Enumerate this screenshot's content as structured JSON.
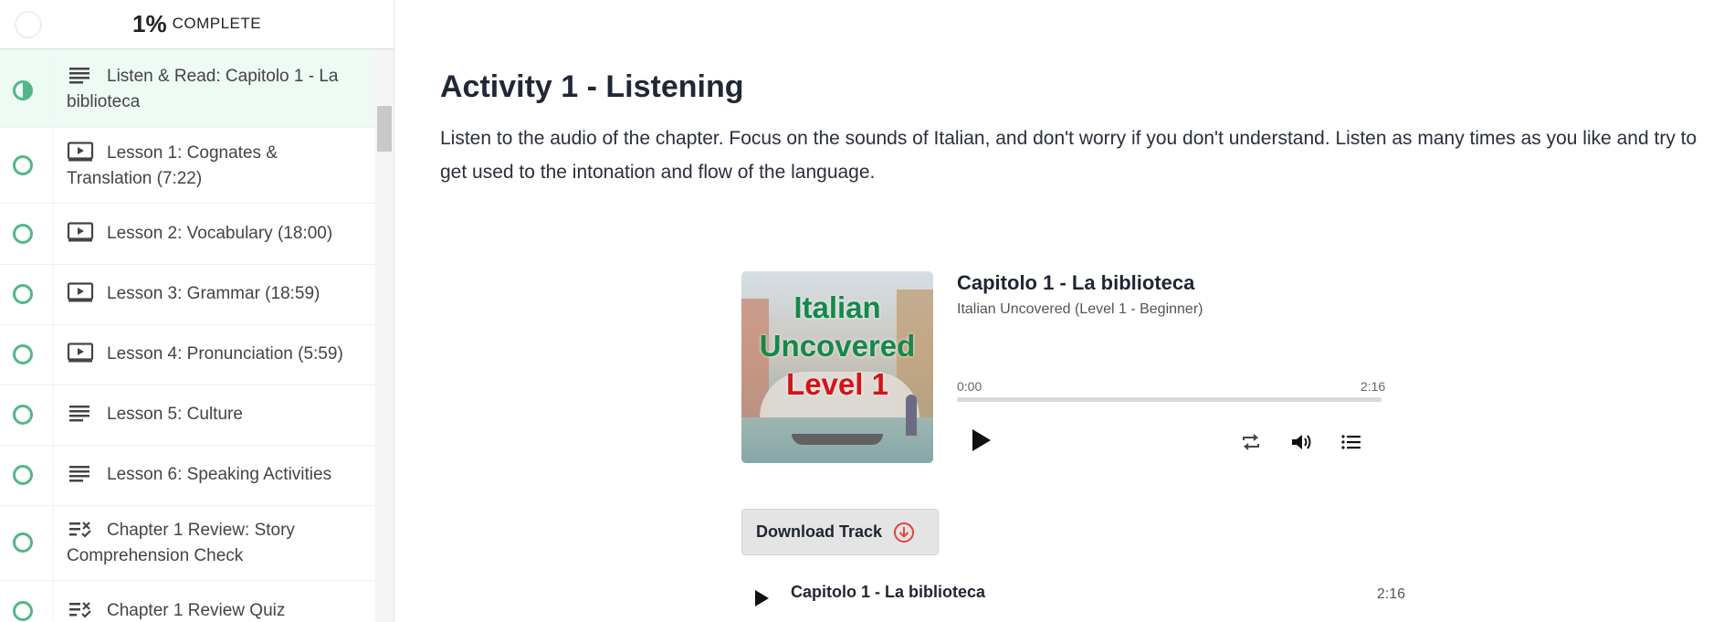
{
  "sidebar": {
    "progress": {
      "percent": "1%",
      "label": "COMPLETE"
    },
    "items": [
      {
        "label": "Listen & Read: Capitolo 1 - La biblioteca",
        "icon": "text-lines-icon",
        "status": "in-progress"
      },
      {
        "label": "Lesson 1: Cognates & Translation (7:22)",
        "icon": "video-icon",
        "status": "not-started"
      },
      {
        "label": "Lesson 2: Vocabulary (18:00)",
        "icon": "video-icon",
        "status": "not-started"
      },
      {
        "label": "Lesson 3: Grammar (18:59)",
        "icon": "video-icon",
        "status": "not-started"
      },
      {
        "label": "Lesson 4: Pronunciation (5:59)",
        "icon": "video-icon",
        "status": "not-started"
      },
      {
        "label": "Lesson 5: Culture",
        "icon": "text-lines-icon",
        "status": "not-started"
      },
      {
        "label": "Lesson 6: Speaking Activities",
        "icon": "text-lines-icon",
        "status": "not-started"
      },
      {
        "label": "Chapter 1 Review: Story Comprehension Check",
        "icon": "quiz-icon",
        "status": "not-started"
      },
      {
        "label": "Chapter 1 Review Quiz",
        "icon": "quiz-icon",
        "status": "not-started"
      }
    ]
  },
  "main": {
    "title": "Activity 1 - Listening",
    "description": "Listen to the audio of the chapter. Focus on the sounds of Italian, and don't worry if you don't understand. Listen as many times as you like and try to get used to the intonation and flow of the language."
  },
  "player": {
    "cover": {
      "line1": "Italian",
      "line2": "Uncovered",
      "line3": "Level 1"
    },
    "track_title": "Capitolo 1 - La biblioteca",
    "track_subtitle": "Italian Uncovered (Level 1 - Beginner)",
    "current_time": "0:00",
    "duration": "2:16",
    "progress_fraction": 0
  },
  "download": {
    "label": "Download Track"
  },
  "tracklist": [
    {
      "title": "Capitolo 1 - La biblioteca",
      "duration": "2:16"
    }
  ],
  "colors": {
    "accent_green": "#52b788",
    "download_red": "#e0443c",
    "active_row_bg": "#eefaf4"
  }
}
